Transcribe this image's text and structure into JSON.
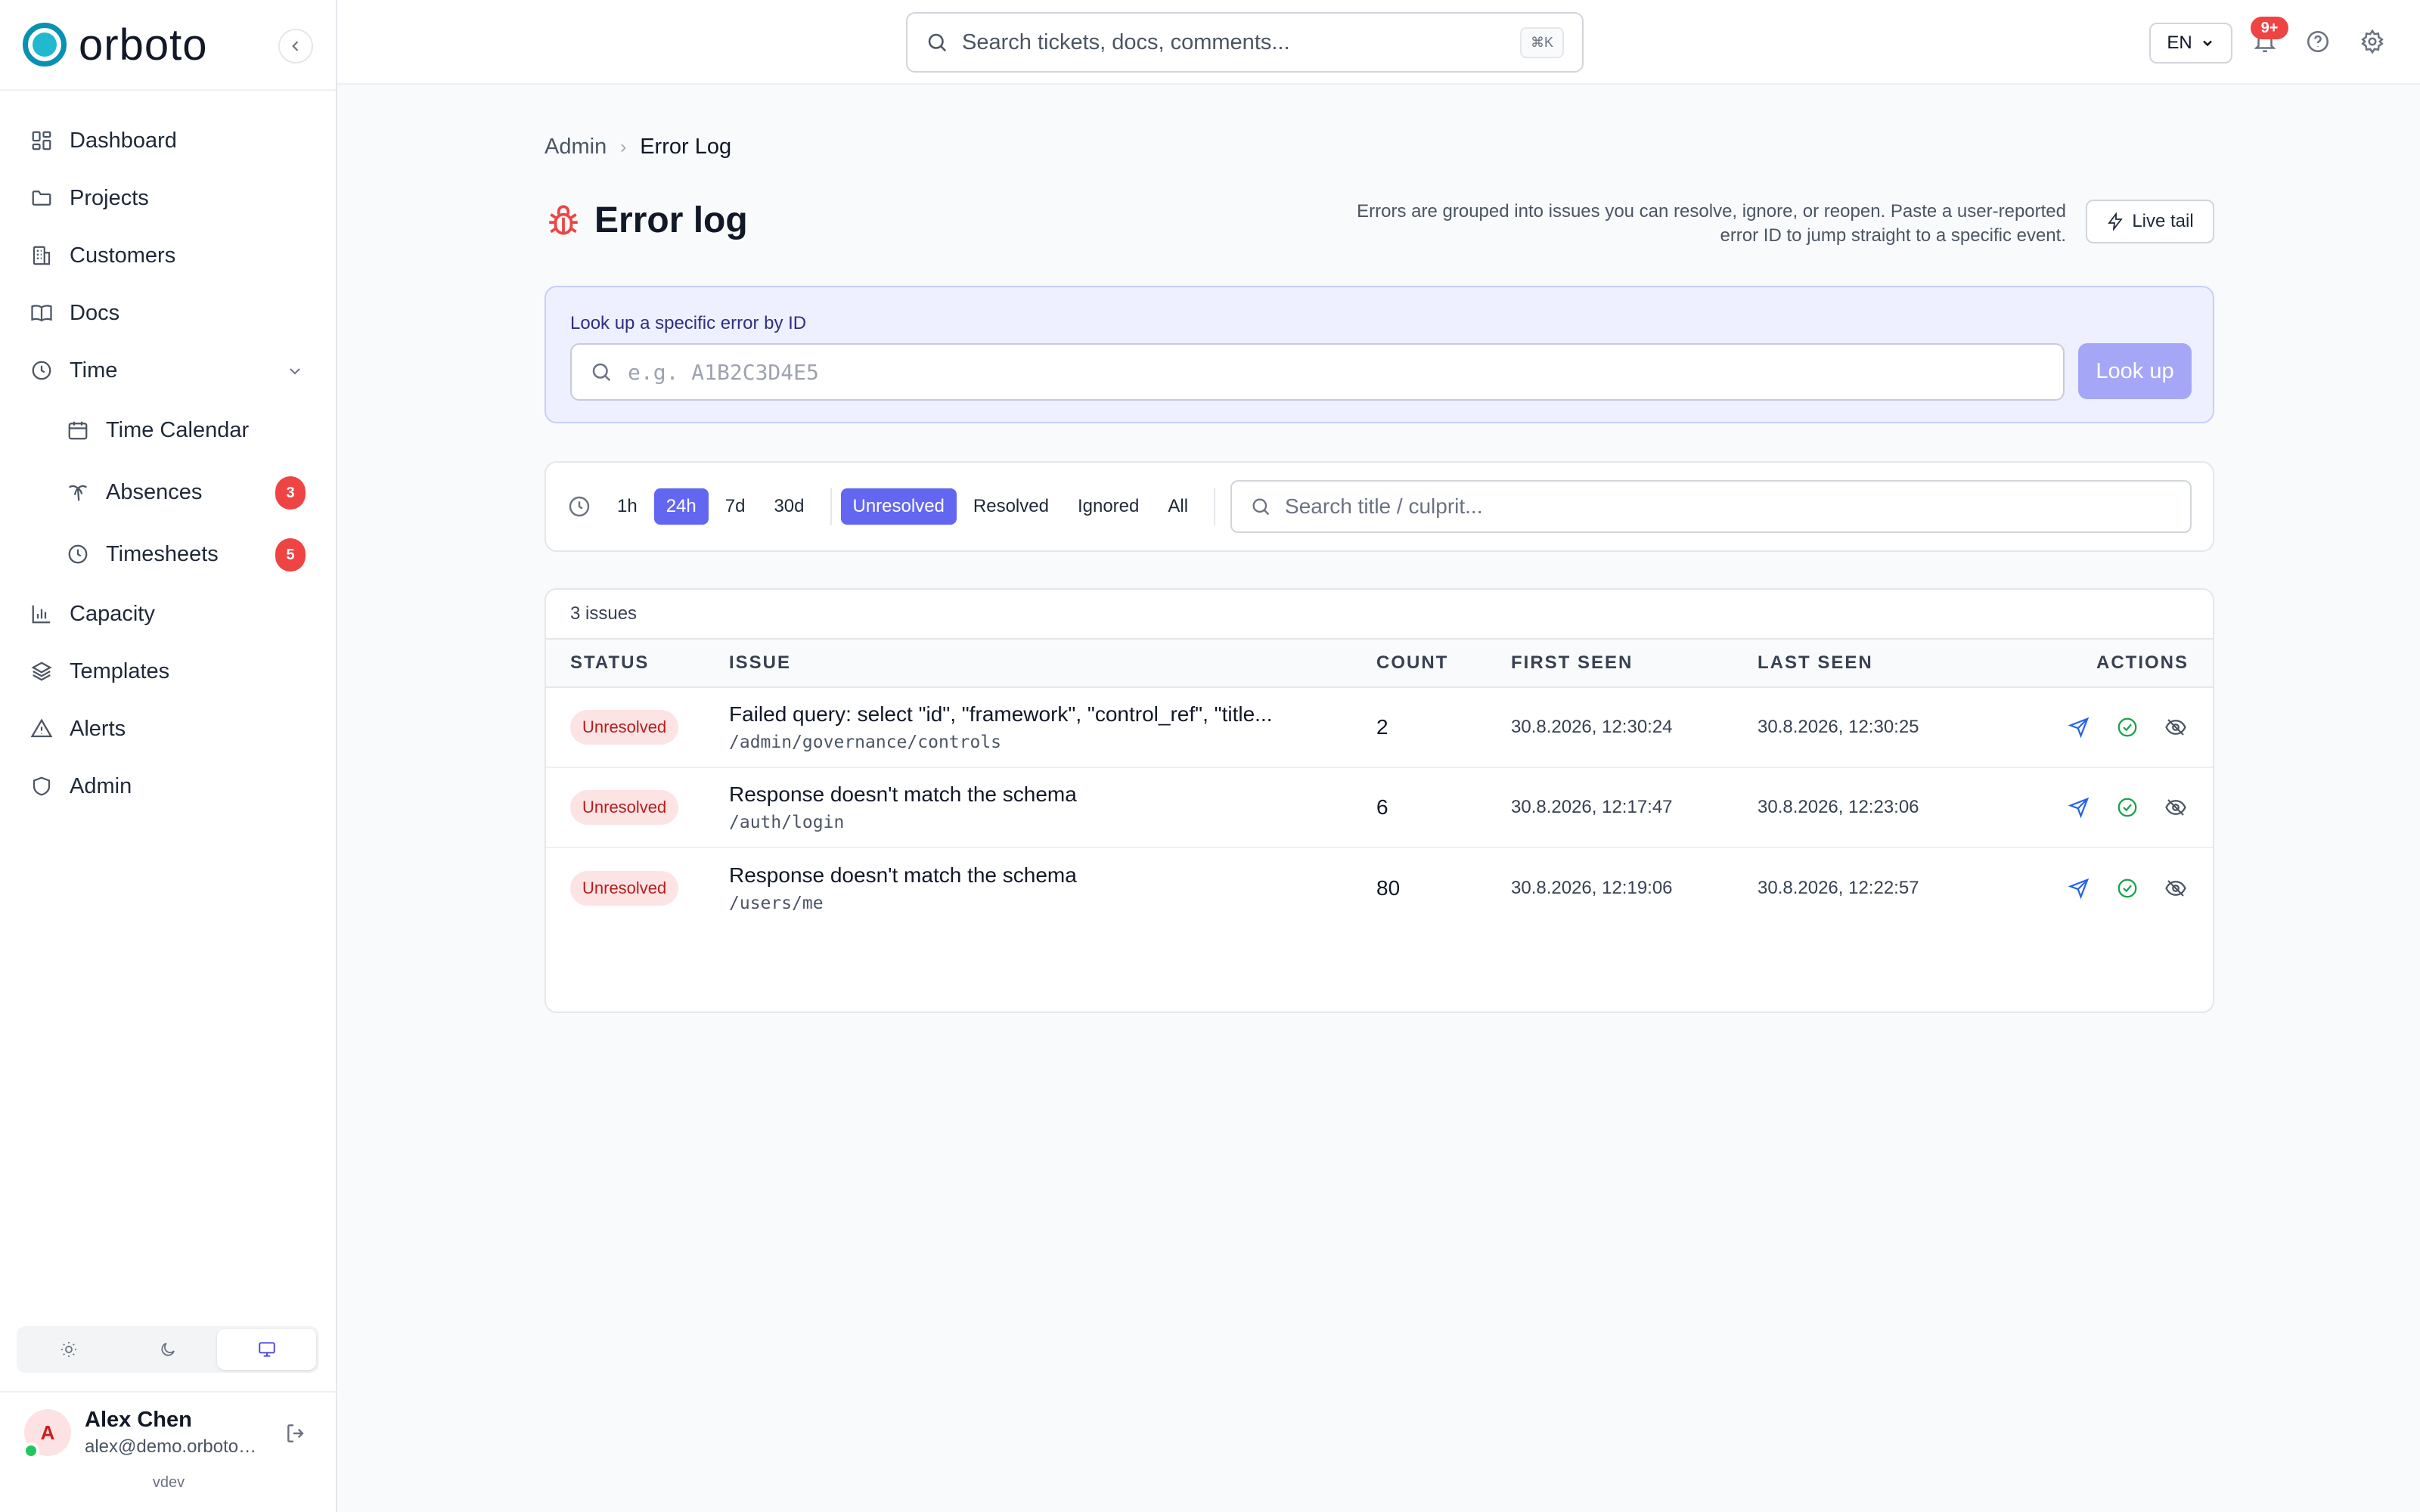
{
  "app": {
    "brand": "orboto",
    "version": "vdev"
  },
  "sidebar": {
    "items": [
      {
        "label": "Dashboard"
      },
      {
        "label": "Projects"
      },
      {
        "label": "Customers"
      },
      {
        "label": "Docs"
      },
      {
        "label": "Time"
      },
      {
        "label": "Time Calendar"
      },
      {
        "label": "Absences",
        "badge": "3"
      },
      {
        "label": "Timesheets",
        "badge": "5"
      },
      {
        "label": "Capacity"
      },
      {
        "label": "Templates"
      },
      {
        "label": "Alerts"
      },
      {
        "label": "Admin"
      }
    ],
    "user": {
      "initial": "A",
      "name": "Alex Chen",
      "email": "alex@demo.orboto.com"
    }
  },
  "topbar": {
    "search_placeholder": "Search tickets, docs, comments...",
    "shortcut": "⌘K",
    "language": "EN",
    "notifications": "9+"
  },
  "breadcrumb": {
    "parent": "Admin",
    "current": "Error Log"
  },
  "page": {
    "title": "Error log",
    "description": "Errors are grouped into issues you can resolve, ignore, or reopen. Paste a user-reported error ID to jump straight to a specific event.",
    "live_tail": "Live tail"
  },
  "lookup": {
    "label": "Look up a specific error by ID",
    "placeholder": "e.g. A1B2C3D4E5",
    "button": "Look up"
  },
  "filters": {
    "ranges": [
      "1h",
      "24h",
      "7d",
      "30d"
    ],
    "active_range": "24h",
    "statuses": [
      "Unresolved",
      "Resolved",
      "Ignored",
      "All"
    ],
    "active_status": "Unresolved",
    "search_placeholder": "Search title / culprit..."
  },
  "table": {
    "summary": "3 issues",
    "headers": {
      "status": "STATUS",
      "issue": "ISSUE",
      "count": "COUNT",
      "first_seen": "FIRST SEEN",
      "last_seen": "LAST SEEN",
      "actions": "ACTIONS"
    },
    "rows": [
      {
        "status": "Unresolved",
        "title": "Failed query: select \"id\", \"framework\", \"control_ref\", \"title...",
        "path": "/admin/governance/controls",
        "count": "2",
        "first_seen": "30.8.2026, 12:30:24",
        "last_seen": "30.8.2026, 12:30:25"
      },
      {
        "status": "Unresolved",
        "title": "Response doesn't match the schema",
        "path": "/auth/login",
        "count": "6",
        "first_seen": "30.8.2026, 12:17:47",
        "last_seen": "30.8.2026, 12:23:06"
      },
      {
        "status": "Unresolved",
        "title": "Response doesn't match the schema",
        "path": "/users/me",
        "count": "80",
        "first_seen": "30.8.2026, 12:19:06",
        "last_seen": "30.8.2026, 12:22:57"
      }
    ]
  },
  "colors": {
    "accent": "#6366f1",
    "brand": "#0891b2",
    "danger": "#ef4444",
    "resolve": "#16a34a",
    "share": "#2563eb"
  }
}
